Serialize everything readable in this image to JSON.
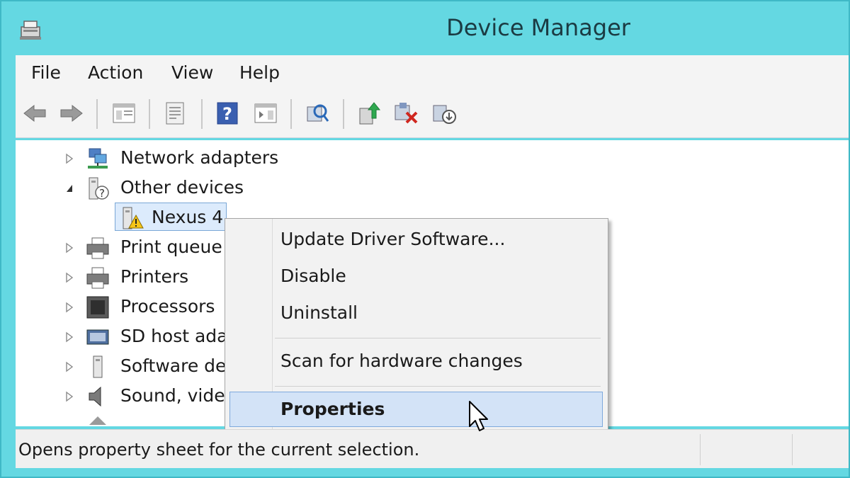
{
  "window": {
    "title": "Device Manager"
  },
  "menu": [
    "File",
    "Action",
    "View",
    "Help"
  ],
  "tree": [
    {
      "label": "Network adapters",
      "expander": "collapsed",
      "icon": "network-adapter-icon"
    },
    {
      "label": "Other devices",
      "expander": "expanded",
      "icon": "other-devices-icon"
    },
    {
      "label": "Nexus 4",
      "expander": "none",
      "icon": "warning-device-icon",
      "selected": true
    },
    {
      "label": "Print queue",
      "expander": "collapsed",
      "icon": "printer-icon"
    },
    {
      "label": "Printers",
      "expander": "collapsed",
      "icon": "printer-icon"
    },
    {
      "label": "Processors",
      "expander": "collapsed",
      "icon": "processor-icon"
    },
    {
      "label": "SD host ada",
      "expander": "collapsed",
      "icon": "sd-host-icon"
    },
    {
      "label": "Software de",
      "expander": "collapsed",
      "icon": "software-device-icon"
    },
    {
      "label": "Sound, vide",
      "expander": "collapsed",
      "icon": "speaker-icon"
    }
  ],
  "context_menu": {
    "items": [
      "Update Driver Software...",
      "Disable",
      "Uninstall",
      "Scan for hardware changes",
      "Properties"
    ],
    "highlighted": "Properties"
  },
  "status": {
    "text": "Opens property sheet for the current selection."
  },
  "colors": {
    "titlebar": "#64d8e2",
    "highlight": "#d3e3f7",
    "highlight_border": "#7ea9dc"
  }
}
